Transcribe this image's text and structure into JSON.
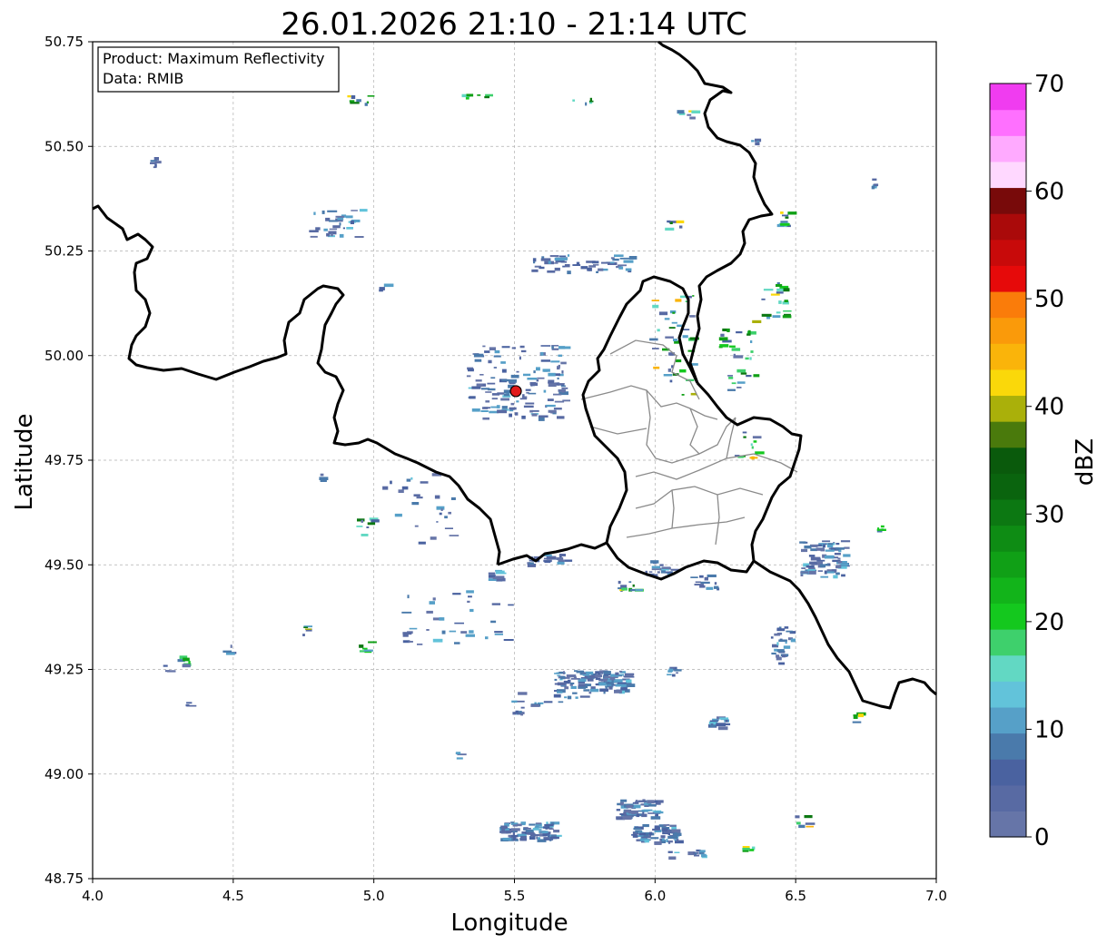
{
  "title": "26.01.2026 21:10 - 21:14 UTC",
  "info_box": {
    "product": "Product: Maximum Reflectivity",
    "data": "Data: RMIB"
  },
  "axes": {
    "xlabel": "Longitude",
    "ylabel": "Latitude",
    "xlim": [
      4.0,
      7.0
    ],
    "ylim": [
      48.75,
      50.75
    ],
    "xticks": [
      "4.0",
      "4.5",
      "5.0",
      "5.5",
      "6.0",
      "6.5",
      "7.0"
    ],
    "yticks": [
      "48.75",
      "49.00",
      "49.25",
      "49.50",
      "49.75",
      "50.00",
      "50.25",
      "50.50",
      "50.75"
    ],
    "grid": true
  },
  "colorbar": {
    "label": "dBZ",
    "ticks": [
      "0",
      "10",
      "20",
      "30",
      "40",
      "50",
      "60",
      "70"
    ],
    "range": [
      0,
      70
    ],
    "colors": [
      "#6675a8",
      "#586aa3",
      "#4a62a0",
      "#4a7aab",
      "#56a0c8",
      "#62c3da",
      "#62d8c3",
      "#3ed06c",
      "#14c81e",
      "#12b41a",
      "#10a016",
      "#0e8c14",
      "#0c7812",
      "#0a640e",
      "#0a5a0c",
      "#4a7a0c",
      "#aab00a",
      "#fad80a",
      "#fab40a",
      "#fa9a0a",
      "#fa7c0a",
      "#e60a0a",
      "#c80a0a",
      "#aa0a0a",
      "#780a0a",
      "#ffd8ff",
      "#ffaaff",
      "#ff70ff",
      "#f03cf0"
    ]
  },
  "radar_site": {
    "name": "radar-site",
    "lon": 5.505,
    "lat": 49.915,
    "color": "#e11a1a"
  },
  "map_features": [
    "national-border",
    "regional-boundaries"
  ]
}
